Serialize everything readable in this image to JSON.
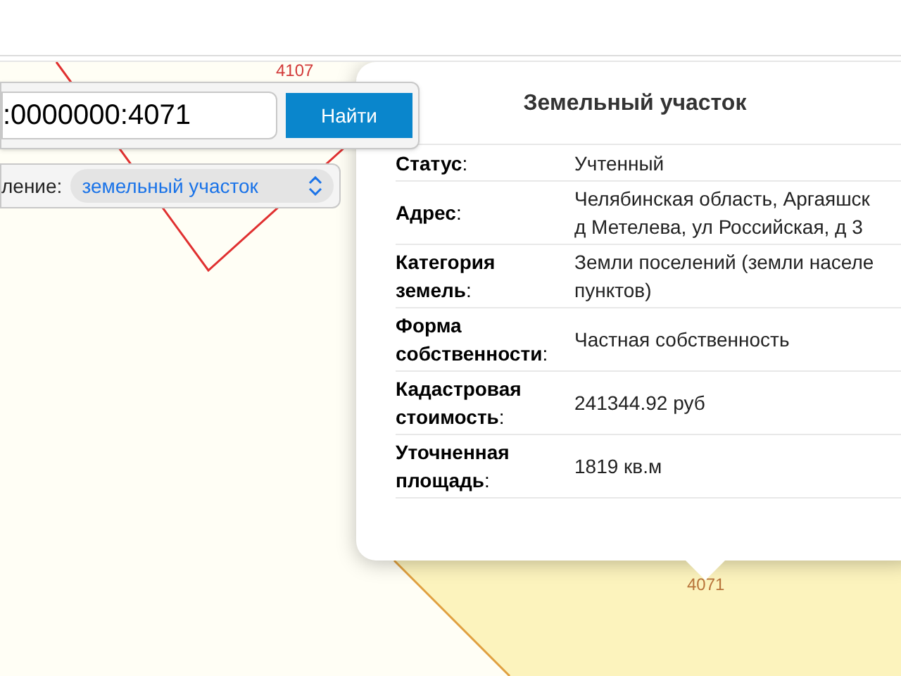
{
  "map": {
    "labels": [
      {
        "text": "4107",
        "kind": "parcel"
      },
      {
        "text": "4071",
        "kind": "selected"
      }
    ]
  },
  "search": {
    "value": ":0000000:4071",
    "button": "Найти"
  },
  "filter": {
    "label": "ление:",
    "value": "земельный участок"
  },
  "popup": {
    "title": "Земельный участок",
    "rows": [
      {
        "label": "**Статус**:",
        "value": [
          "Учтенный"
        ]
      },
      {
        "label": "**Адрес**:",
        "value": [
          "Челябинская область, Аргаяшск",
          "д Метелева, ул Российская, д 3"
        ]
      },
      {
        "label": "**Категория земель**:",
        "value": [
          "Земли поселений (земли населе",
          "пунктов)"
        ]
      },
      {
        "label": "**Форма собственности**:",
        "value": [
          "Частная собственность"
        ]
      },
      {
        "label": "**Кадастровая стоимость**:",
        "value": [
          "241344.92 руб"
        ]
      },
      {
        "label": "**Уточненная площадь**:",
        "value": [
          "1819 кв.м"
        ]
      }
    ]
  }
}
